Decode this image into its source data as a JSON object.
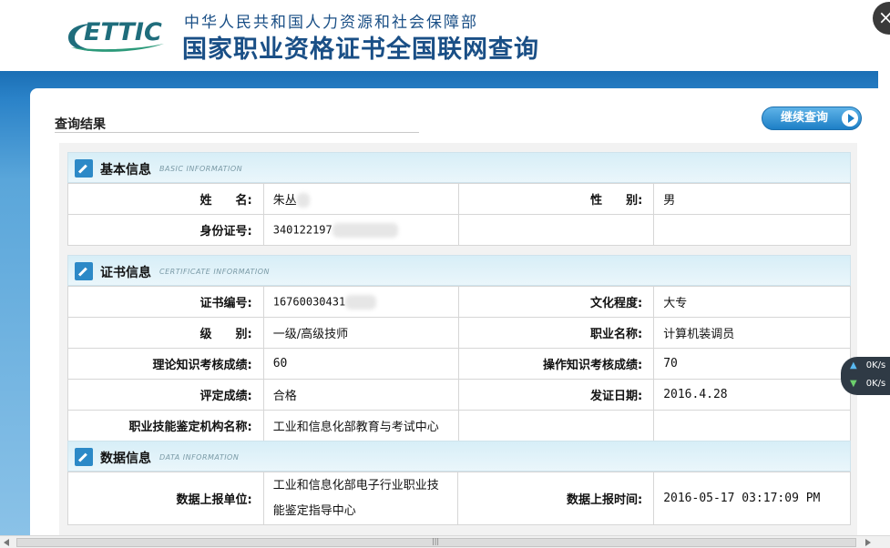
{
  "header": {
    "logo_text": "ETTIC",
    "ministry": "中华人民共和国人力资源和社会保障部",
    "site_title": "国家职业资格证书全国联网查询"
  },
  "result": {
    "title": "查询结果",
    "continue_label": "继续查询"
  },
  "sections": {
    "basic": {
      "title": "基本信息",
      "subtitle": "BASIC INFORMATION"
    },
    "certificate": {
      "title": "证书信息",
      "subtitle": "CERTIFICATE INFORMATION"
    },
    "data": {
      "title": "数据信息",
      "subtitle": "DATA INFORMATION"
    }
  },
  "basic": {
    "name_label": "姓　　名:",
    "name_value": "朱丛",
    "gender_label": "性　　别:",
    "gender_value": "男",
    "id_label": "身份证号:",
    "id_value": "340122197"
  },
  "certificate": {
    "cert_no_label": "证书编号:",
    "cert_no_value": "16760030431",
    "education_label": "文化程度:",
    "education_value": "大专",
    "level_label": "级　　别:",
    "level_value": "一级/高级技师",
    "occupation_label": "职业名称:",
    "occupation_value": "计算机装调员",
    "theory_label": "理论知识考核成绩:",
    "theory_value": "60",
    "practice_label": "操作知识考核成绩:",
    "practice_value": "70",
    "rating_label": "评定成绩:",
    "rating_value": "合格",
    "issue_label": "发证日期:",
    "issue_value": "2016.4.28",
    "org_label": "职业技能鉴定机构名称:",
    "org_value": "工业和信息化部教育与考试中心"
  },
  "data_info": {
    "unit_label": "数据上报单位:",
    "unit_value_line1": "工业和信息化部电子行业职业技",
    "unit_value_line2": "能鉴定指导中心",
    "time_label": "数据上报时间:",
    "time_value": "2016-05-17 03:17:09 PM"
  },
  "speed_widget": {
    "up": "0K/s",
    "down": "0K/s"
  },
  "close_label": "×",
  "scroll_grip": "|||"
}
